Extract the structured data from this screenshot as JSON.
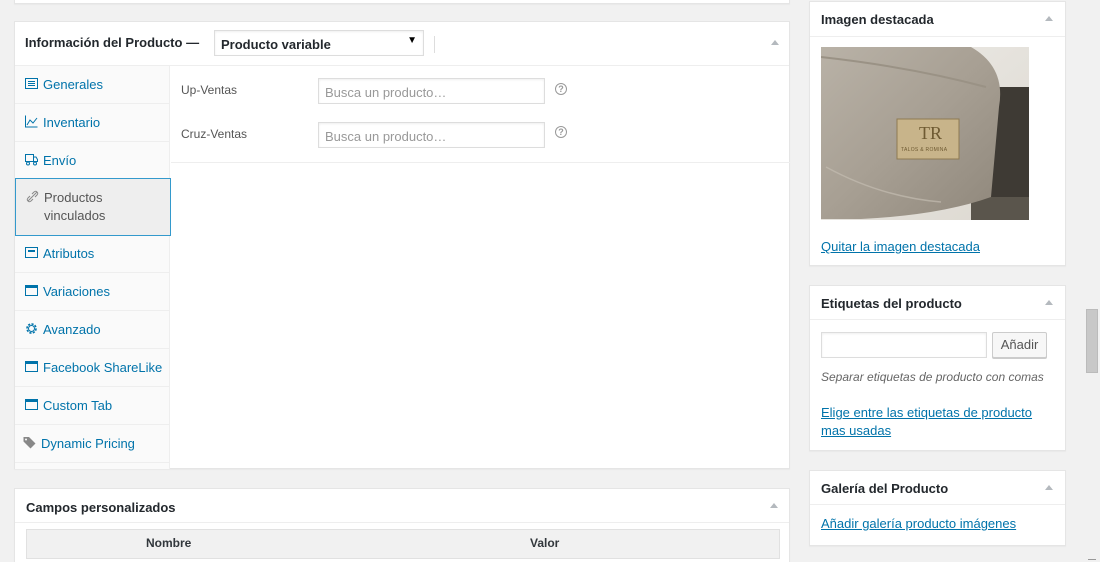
{
  "product_data": {
    "title": "Información del Producto —",
    "product_type": "Producto variable",
    "tabs": [
      {
        "label": "Generales",
        "icon": "list-icon"
      },
      {
        "label": "Inventario",
        "icon": "chart-icon"
      },
      {
        "label": "Envío",
        "icon": "truck-icon"
      },
      {
        "label": "Productos vinculados",
        "icon": "link-icon"
      },
      {
        "label": "Atributos",
        "icon": "attributes-icon"
      },
      {
        "label": "Variaciones",
        "icon": "window-icon"
      },
      {
        "label": "Avanzado",
        "icon": "gear-icon"
      },
      {
        "label": "Facebook ShareLike",
        "icon": "window-icon"
      },
      {
        "label": "Custom Tab",
        "icon": "window-icon"
      },
      {
        "label": "Dynamic Pricing",
        "icon": "tag-icon"
      }
    ],
    "active_tab": "Productos vinculados",
    "fields": {
      "upsells_label": "Up-Ventas",
      "upsells_placeholder": "Busca un producto…",
      "crosssells_label": "Cruz-Ventas",
      "crosssells_placeholder": "Busca un producto…"
    }
  },
  "custom_fields": {
    "title": "Campos personalizados",
    "columns": [
      "Nombre",
      "Valor"
    ]
  },
  "featured_image": {
    "title": "Imagen destacada",
    "remove_link": "Quitar la imagen destacada",
    "logo_initials": "TR",
    "logo_caption": "TALOS & ROMINA"
  },
  "product_tags": {
    "title": "Etiquetas del producto",
    "add_button": "Añadir",
    "help": "Separar etiquetas de producto con comas",
    "popular_link": "Elige entre las etiquetas de producto mas usadas"
  },
  "gallery": {
    "title": "Galería del Producto",
    "add_link": "Añadir galería producto imágenes"
  },
  "colors": {
    "link": "#0073aa",
    "active_border": "#3399cc",
    "background": "#f1f1f1"
  }
}
